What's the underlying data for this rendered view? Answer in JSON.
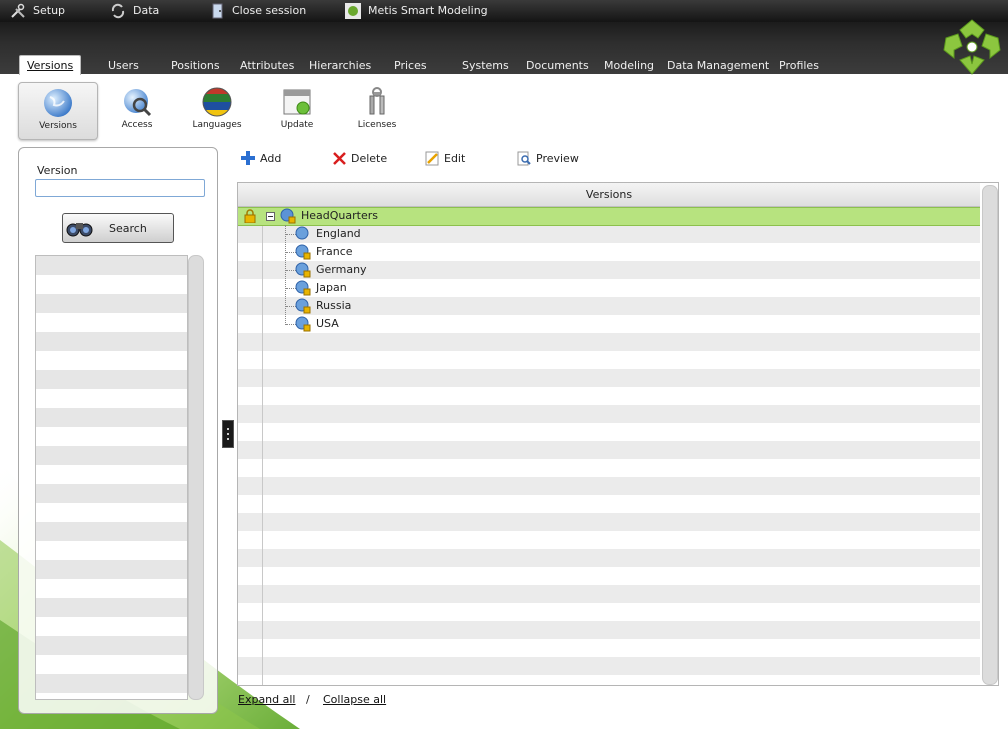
{
  "topbar": {
    "setup": "Setup",
    "data": "Data",
    "close_session": "Close session",
    "app_title": "Metis Smart Modeling"
  },
  "tabs": [
    "Versions",
    "Users",
    "Positions",
    "Attributes",
    "Hierarchies",
    "Prices",
    "Systems",
    "Documents",
    "Modeling",
    "Data Management",
    "Profiles"
  ],
  "tools": [
    "Versions",
    "Access",
    "Languages",
    "Update",
    "Licenses"
  ],
  "left_panel": {
    "version_label": "Version",
    "version_value": "",
    "search_label": "Search"
  },
  "actions": {
    "add": "Add",
    "delete": "Delete",
    "edit": "Edit",
    "preview": "Preview"
  },
  "grid": {
    "header": "Versions",
    "root": "HeadQuarters",
    "children": [
      "England",
      "France",
      "Germany",
      "Japan",
      "Russia",
      "USA"
    ]
  },
  "footer": {
    "expand_all": "Expand all",
    "separator": "/",
    "collapse_all": "Collapse all"
  },
  "colors": {
    "selected_row": "#b7e37f",
    "brand_green": "#7cb83a"
  }
}
